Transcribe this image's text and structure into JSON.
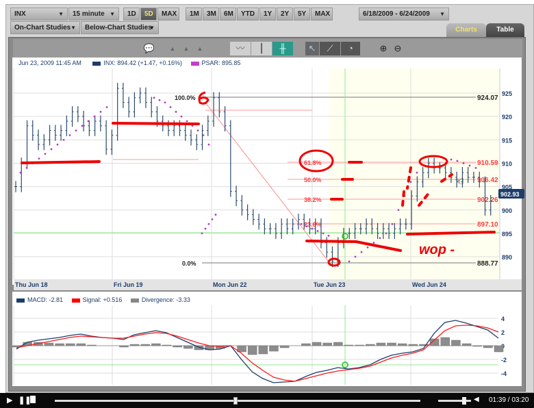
{
  "toolbar": {
    "symbol": "INX",
    "interval": "15 minute",
    "ranges_a": [
      "1D",
      "5D",
      "MAX"
    ],
    "ranges_b": [
      "1M",
      "3M",
      "6M",
      "YTD",
      "1Y",
      "2Y",
      "5Y",
      "MAX"
    ],
    "active_range": "5D",
    "date_range": "6/18/2009 - 6/24/2009",
    "on_chart": "On-Chart Studies",
    "below_chart": "Below-Chart Studies"
  },
  "tabs": [
    {
      "label": "Charts",
      "active": true
    },
    {
      "label": "Table",
      "active": false
    }
  ],
  "icons": [
    "comment-icon",
    "month-marker-icon",
    "week-marker-icon",
    "day-marker-icon",
    "line-chart-icon",
    "candlestick-icon",
    "ohlc-bar-icon",
    "pointer-icon",
    "trendline-icon",
    "fibonacci-icon",
    "zoom-in-icon",
    "zoom-out-icon"
  ],
  "legend": {
    "date": "Jun 23, 2009 11:45 AM",
    "inx": "INX: 894.42 (+1.47, +0.16%)",
    "psar": "PSAR: 895.85"
  },
  "macd_legend": {
    "macd": "MACD: -2.81",
    "signal": "Signal: +0.516",
    "divergence": "Divergence: -3.33"
  },
  "colors": {
    "price": "#2a4a6e",
    "psar": "#b040c0",
    "macd": "#1d3d6b",
    "signal": "#ff1a1a",
    "divergence": "#888888",
    "fib": "#ff3b3b",
    "crosshair": "#90e890",
    "annotation": "#ee0000"
  },
  "video": {
    "current": "01:39",
    "total": "03:20",
    "progress": 0.495,
    "volume": 0.8
  },
  "annotation_text": "wop -",
  "chart_data": [
    {
      "type": "ohlc",
      "title": "INX 15 minute",
      "ylim": [
        885,
        928
      ],
      "y_ticks": [
        890,
        895,
        900,
        905,
        910,
        915,
        920,
        925
      ],
      "x_labels": [
        "Thu Jun 18",
        "Fri Jun 19",
        "Mon Jun 22",
        "Tue Jun 23",
        "Wed Jun 24"
      ],
      "closes": [
        905,
        910,
        918,
        916,
        914,
        915,
        917,
        916,
        917,
        919,
        921,
        920,
        918,
        917,
        919,
        918,
        913,
        916,
        926,
        923,
        921,
        924,
        925,
        923,
        921,
        919,
        918,
        917,
        918,
        917,
        916,
        915,
        914,
        917,
        919,
        924,
        921,
        918,
        904,
        902,
        900,
        899,
        898,
        897,
        896,
        896,
        895,
        897,
        896,
        897,
        898,
        897,
        896,
        897,
        893,
        891,
        889,
        893,
        895,
        895,
        896,
        896,
        897,
        896,
        895,
        896,
        895,
        896,
        897,
        897,
        903,
        906,
        908,
        910,
        909,
        909,
        908,
        907,
        906,
        908,
        907,
        907,
        906,
        900,
        902
      ],
      "psar": [
        [
          908,
          909,
          910,
          911,
          912,
          913,
          914,
          915,
          916,
          917,
          918,
          919,
          920,
          921,
          922
        ],
        [
          924,
          923.5,
          923,
          922,
          921,
          920,
          919,
          918,
          917,
          916,
          914
        ],
        [
          895,
          896,
          897,
          898,
          899
        ],
        [
          897,
          896.5,
          896,
          895.5,
          895,
          894.5
        ],
        [
          889,
          890,
          891,
          892,
          893,
          894,
          895,
          897,
          900,
          903,
          906,
          908
        ],
        [
          911,
          910.8,
          910.5,
          910,
          909.5,
          909
        ]
      ],
      "fibonacci": [
        {
          "label": "100.0%",
          "value": "924.07"
        },
        {
          "label": "61.8%",
          "value": "910.59"
        },
        {
          "label": "50.0%",
          "value": "906.42"
        },
        {
          "label": "38.2%",
          "value": "902.26"
        },
        {
          "label": "23.6%",
          "value": "897.10"
        },
        {
          "label": "0.0%",
          "value": "888.77"
        }
      ],
      "last_price": "902.93",
      "crosshair_price": 895
    },
    {
      "type": "line",
      "title": "MACD",
      "ylim": [
        -5,
        5
      ],
      "y_ticks": [
        "4",
        "2",
        "0",
        "-2",
        "-4"
      ],
      "series": [
        {
          "name": "MACD",
          "values": [
            -0.5,
            0.5,
            0.8,
            1,
            1.2,
            1.5,
            1.7,
            1.4,
            1.2,
            1.1,
            0.9,
            1.6,
            1.9,
            2.2,
            1.9,
            1.2,
            0.5,
            -0.2,
            -0.6,
            -0.5,
            0,
            -2,
            -3.8,
            -4.8,
            -5.4,
            -5.3,
            -5.2,
            -4.5,
            -3.9,
            -3.6,
            -3.2,
            -3.4,
            -3.2,
            -2.8,
            -2,
            -1.4,
            -1.1,
            -0.9,
            -0.4,
            1.8,
            3.4,
            3.7,
            3.3,
            2.8,
            2.3,
            1.1
          ]
        },
        {
          "name": "Signal",
          "values": [
            -0.3,
            0,
            0.3,
            0.6,
            0.9,
            1.2,
            1.4,
            1.3,
            1.2,
            1.1,
            1.1,
            1.4,
            1.7,
            1.9,
            1.8,
            1.4,
            0.9,
            0.4,
            0,
            -0.1,
            0,
            -1.1,
            -2.5,
            -3.6,
            -4.6,
            -5,
            -5.2,
            -4.8,
            -4.4,
            -4,
            -3.7,
            -3.5,
            -3.3,
            -3,
            -2.4,
            -1.8,
            -1.4,
            -1.1,
            -0.6,
            0.8,
            2.2,
            2.9,
            3,
            2.9,
            2.6,
            2
          ]
        },
        {
          "name": "Divergence",
          "values": [
            -0.2,
            0.5,
            0.5,
            0.4,
            0.3,
            0.3,
            0.3,
            0.1,
            0,
            0,
            -0.2,
            0.2,
            0.2,
            0.3,
            0.1,
            -0.2,
            -0.4,
            -0.6,
            -0.6,
            -0.4,
            0,
            -0.9,
            -1.3,
            -1.2,
            -0.8,
            -0.3,
            0,
            0.3,
            0.5,
            0.4,
            0.5,
            0.1,
            0.1,
            0.2,
            0.4,
            0.4,
            0.3,
            0.2,
            0.2,
            1,
            1.2,
            0.8,
            0.3,
            -0.1,
            -0.3,
            -0.9
          ]
        }
      ]
    }
  ]
}
